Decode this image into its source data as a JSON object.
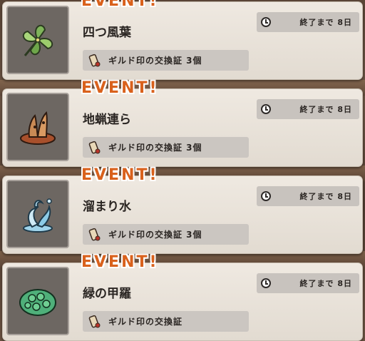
{
  "events": [
    {
      "banner": "EVENT!",
      "name": "四つ風葉",
      "icon": "pinwheel-leaf-icon",
      "timer": "終了まで 8日",
      "reward": "ギルド印の交換証 3個"
    },
    {
      "banner": "EVENT!",
      "name": "地蝋連ら",
      "icon": "clay-pot-icon",
      "timer": "終了まで 8日",
      "reward": "ギルド印の交換証 3個"
    },
    {
      "banner": "EVENT!",
      "name": "溜まり水",
      "icon": "water-splash-icon",
      "timer": "終了まで 8日",
      "reward": "ギルド印の交換証 3個"
    },
    {
      "banner": "EVENT!",
      "name": "緑の甲羅",
      "icon": "green-shell-icon",
      "timer": "終了まで 8日",
      "reward": "ギルド印の交換証"
    }
  ],
  "colors": {
    "event_orange": "#d9611c",
    "card_bg": "#e9e3db",
    "thumb_bg": "#6d6762"
  }
}
